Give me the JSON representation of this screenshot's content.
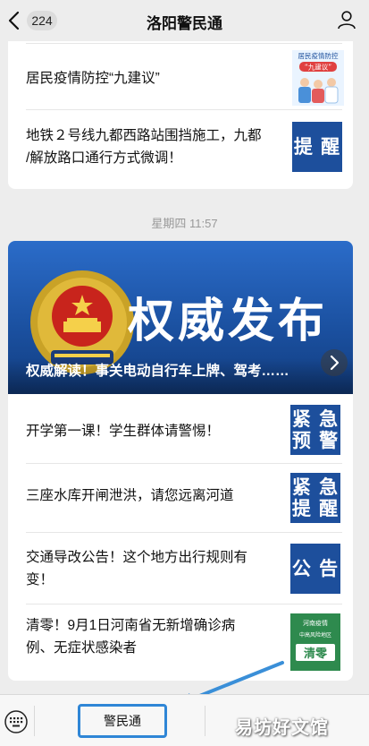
{
  "header": {
    "unread_count": "224",
    "title": "洛阳警民通"
  },
  "card1": {
    "items": [
      {
        "text": "居民疫情防控“九建议”",
        "thumb_title": "居民疫情防控",
        "thumb_sub": "“九建议”"
      },
      {
        "text_line1": "地铁２号线九都西路站围挡施工，九都",
        "text_line2": "/解放路口通行方式微调！",
        "thumb_lines": [
          "提 醒"
        ]
      }
    ]
  },
  "timestamp": "星期四 11:57",
  "card2": {
    "banner": {
      "big_text": "权威发布",
      "caption": "权威解读！事关电动自行车上牌、驾考……"
    },
    "items": [
      {
        "text": "开学第一课！学生群体请警惕！",
        "thumb_lines": [
          "紧 急",
          "预 警"
        ]
      },
      {
        "text": "三座水库开闸泄洪，请您远离河道",
        "thumb_lines": [
          "紧 急",
          "提 醒"
        ]
      },
      {
        "text_line1": "交通导改公告！这个地方出行规则有",
        "text_line2": "变！",
        "thumb_lines": [
          "公 告"
        ]
      },
      {
        "text_line1": "清零！9月1日河南省无新增确诊病",
        "text_line2": "例、无症状感染者",
        "thumb_top": "河南疫情",
        "thumb_mid": "中高风险地区",
        "thumb_big": "清零"
      }
    ]
  },
  "bottom_menu": {
    "button_label": "警民通"
  },
  "watermark": "易坊好文馆",
  "colors": {
    "accent_blue": "#1d4f9c",
    "highlight_border": "#2f86d6",
    "arrow": "#3a8fd8",
    "green_thumb": "#2e8a4e"
  }
}
